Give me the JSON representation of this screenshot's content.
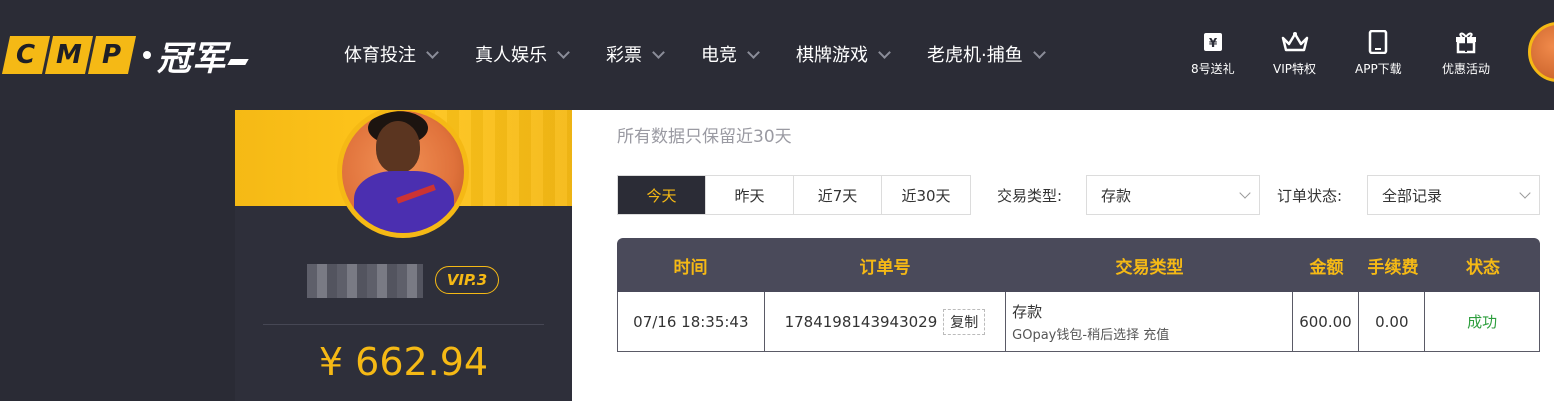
{
  "brand": {
    "letters": [
      "C",
      "M",
      "P"
    ],
    "name_cn": "冠军"
  },
  "nav": [
    {
      "label": "体育投注"
    },
    {
      "label": "真人娱乐"
    },
    {
      "label": "彩票"
    },
    {
      "label": "电竞"
    },
    {
      "label": "棋牌游戏"
    },
    {
      "label": "老虎机·捕鱼"
    }
  ],
  "quick_links": [
    {
      "label": "8号送礼",
      "icon": "gift-box-icon"
    },
    {
      "label": "VIP特权",
      "icon": "crown-icon"
    },
    {
      "label": "APP下载",
      "icon": "phone-icon"
    },
    {
      "label": "优惠活动",
      "icon": "present-icon"
    }
  ],
  "profile": {
    "vip": "VIP.3",
    "balance": "¥ 662.94"
  },
  "notice": "所有数据只保留近30天",
  "date_tabs": [
    "今天",
    "昨天",
    "近7天",
    "近30天"
  ],
  "filters": {
    "type_label": "交易类型:",
    "type_value": "存款",
    "status_label": "订单状态:",
    "status_value": "全部记录"
  },
  "table": {
    "headers": [
      "时间",
      "订单号",
      "交易类型",
      "金额",
      "手续费",
      "状态"
    ],
    "rows": [
      {
        "time": "07/16 18:35:43",
        "order_no": "1784198143943029",
        "copy_label": "复制",
        "type_main": "存款",
        "type_sub": "GOpay钱包-稍后选择 充值",
        "amount": "600.00",
        "fee": "0.00",
        "status": "成功"
      }
    ]
  },
  "colors": {
    "accent": "#f5b915",
    "header_bg": "#2b2c36",
    "success": "#2e9e3e"
  }
}
